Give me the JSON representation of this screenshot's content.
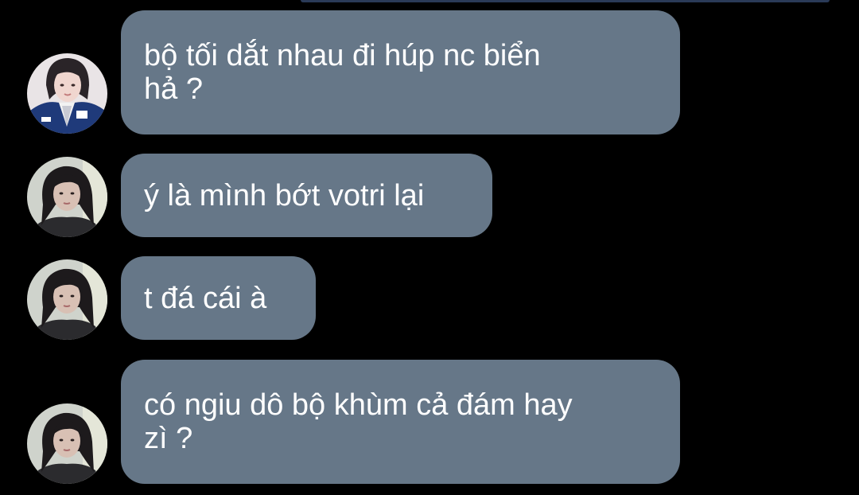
{
  "colors": {
    "background": "#000000",
    "bubble": "#667788",
    "text": "#ffffff",
    "top_edge": "#2a3a57"
  },
  "messages": [
    {
      "sender_avatar": "avatar-jacket",
      "lines": [
        "bộ tối dắt nhau đi húp nc biển",
        "hả ?"
      ]
    },
    {
      "sender_avatar": "avatar-dark-hair",
      "lines": [
        "ý là mình bớt votri lại"
      ]
    },
    {
      "sender_avatar": "avatar-dark-hair",
      "lines": [
        "t đá cái à"
      ]
    },
    {
      "sender_avatar": "avatar-dark-hair",
      "lines": [
        "có ngiu dô bộ khùm cả đám hay",
        "zì ?"
      ]
    }
  ]
}
